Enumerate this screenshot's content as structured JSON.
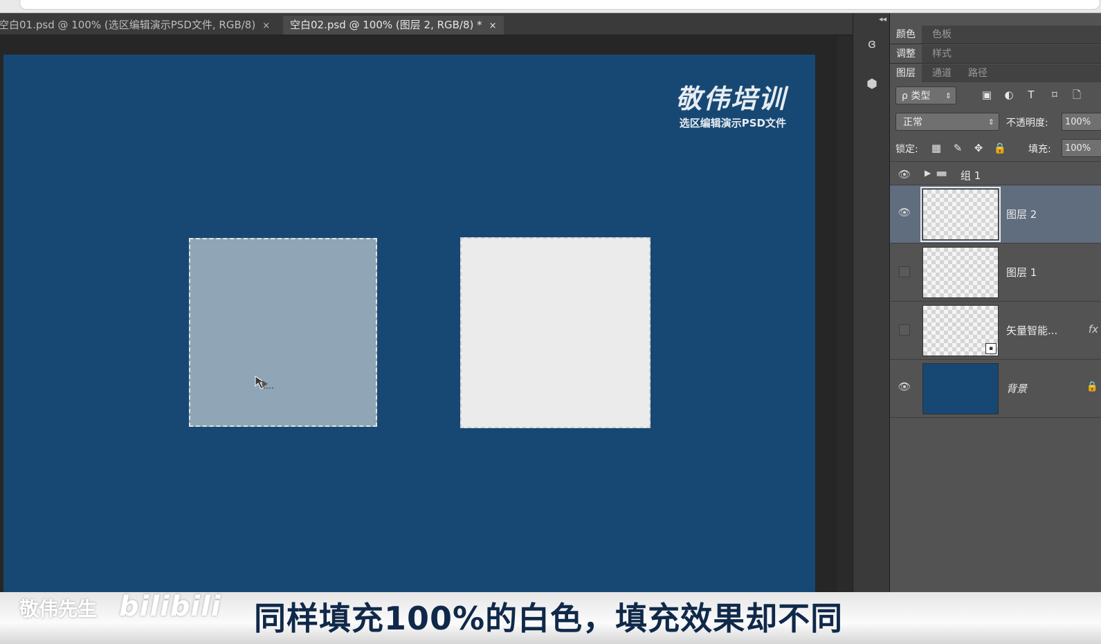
{
  "document_tabs": [
    {
      "title": "空白01.psd @ 100% (选区编辑演示PSD文件, RGB/8)",
      "close": "×"
    },
    {
      "title": "空白02.psd @ 100% (图层 2, RGB/8) *",
      "close": "×"
    }
  ],
  "canvas": {
    "background_color": "#174873",
    "brand_title": "敬伟培训",
    "brand_subtitle": "选区编辑演示PSD文件",
    "square_left_fill": "#90a5b6",
    "square_right_fill": "#ebebeb"
  },
  "dock": {
    "collapse": "◂◂",
    "buttons": [
      {
        "name": "adjust-brush-icon",
        "glyph": "ɞ"
      },
      {
        "name": "3d-cube-icon",
        "glyph": "⬢"
      }
    ]
  },
  "panel": {
    "top_tabs": [
      "颜色",
      "色板"
    ],
    "second_tabs": [
      "调整",
      "样式"
    ],
    "layer_tabs": [
      "图层",
      "通道",
      "路径"
    ],
    "filter_label": "ρ 类型",
    "filter_icons": [
      "▣",
      "◐",
      "T",
      "⌑",
      "🗋"
    ],
    "blend_mode": "正常",
    "opacity_label": "不透明度:",
    "opacity_value": "100%",
    "lock_label": "锁定:",
    "lock_icons": [
      "▦",
      "✎",
      "✥",
      "🔒"
    ],
    "fill_label": "填充:",
    "fill_value": "100%",
    "group": {
      "name": "组 1",
      "arrow": "▶",
      "folder": "▬"
    },
    "layers": [
      {
        "name": "图层 2",
        "visible": true,
        "selected": true
      },
      {
        "name": "图层 1",
        "visible": false,
        "selected": false
      },
      {
        "name": "矢量智能...",
        "visible": false,
        "selected": false,
        "fx": "fx"
      },
      {
        "name": "背景",
        "visible": true,
        "selected": false,
        "locked": true
      }
    ],
    "eye_glyph": "👁",
    "lock_glyph": "🔒"
  },
  "subtitle": {
    "watermark_name": "敬伟先生",
    "watermark_site": "bilibili",
    "text": "同样填充100%的白色，填充效果却不同"
  }
}
